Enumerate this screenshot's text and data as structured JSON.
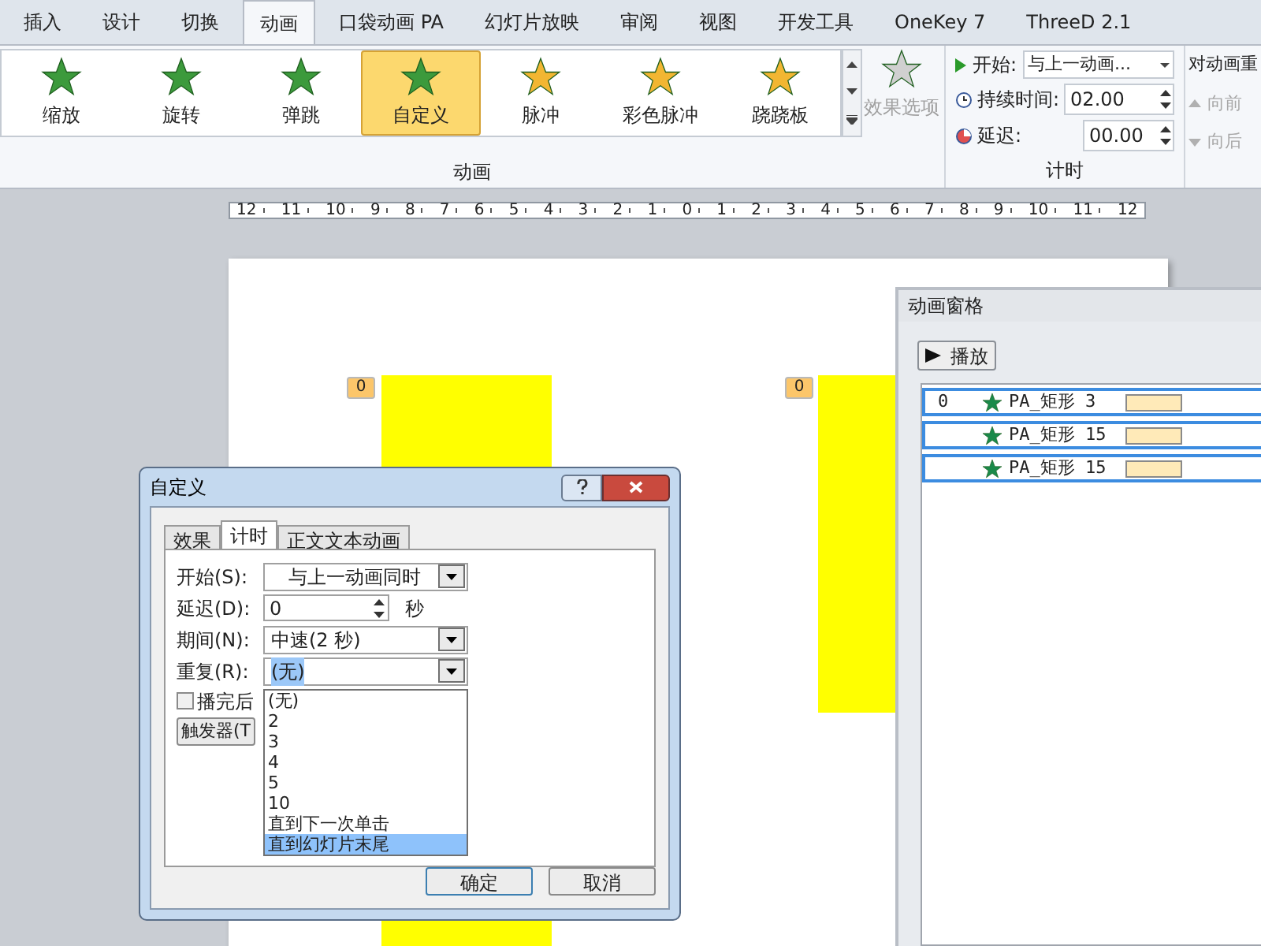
{
  "tabs": [
    {
      "label": "插入",
      "selected": false
    },
    {
      "label": "设计",
      "selected": false
    },
    {
      "label": "切换",
      "selected": false
    },
    {
      "label": "动画",
      "selected": true
    },
    {
      "label": "口袋动画 PA",
      "selected": false
    },
    {
      "label": "幻灯片放映",
      "selected": false
    },
    {
      "label": "审阅",
      "selected": false
    },
    {
      "label": "视图",
      "selected": false
    },
    {
      "label": "开发工具",
      "selected": false
    },
    {
      "label": "OneKey 7",
      "selected": false
    },
    {
      "label": "ThreeD 2.1",
      "selected": false
    }
  ],
  "animation_group": {
    "label": "动画",
    "items": [
      {
        "label": "缩放",
        "kind": "green",
        "selected": false
      },
      {
        "label": "旋转",
        "kind": "green",
        "selected": false
      },
      {
        "label": "弹跳",
        "kind": "green",
        "selected": false
      },
      {
        "label": "自定义",
        "kind": "green",
        "selected": true
      },
      {
        "label": "脉冲",
        "kind": "gold",
        "selected": false
      },
      {
        "label": "彩色脉冲",
        "kind": "gold",
        "selected": false
      },
      {
        "label": "跷跷板",
        "kind": "gold",
        "selected": false
      }
    ],
    "effect_options": {
      "label": "效果选项",
      "disabled": true
    }
  },
  "timing_group": {
    "label": "计时",
    "start": {
      "label": "开始:",
      "value": "与上一动画..."
    },
    "duration": {
      "label": "持续时间:",
      "value": "02.00"
    },
    "delay": {
      "label": "延迟:",
      "value": "00.00"
    }
  },
  "reorder_group": {
    "title": "对动画重",
    "items": [
      {
        "label": "向前",
        "disabled": true
      },
      {
        "label": "向后",
        "disabled": true
      }
    ]
  },
  "ruler": [
    "12",
    "11",
    "10",
    "9",
    "8",
    "7",
    "6",
    "5",
    "4",
    "3",
    "2",
    "1",
    "0",
    "1",
    "2",
    "3",
    "4",
    "5",
    "6",
    "7",
    "8",
    "9",
    "10",
    "11",
    "12"
  ],
  "slide": {
    "shapes": [
      {
        "badge": "0"
      },
      {
        "badge": "0"
      }
    ]
  },
  "animation_pane": {
    "title": "动画窗格",
    "play_button": "播放",
    "items": [
      {
        "index": "0",
        "name": "PA_矩形 3"
      },
      {
        "name": "PA_矩形 15"
      },
      {
        "name": "PA_矩形 15"
      }
    ]
  },
  "dialog": {
    "title": "自定义",
    "tabs": [
      {
        "label": "效果",
        "selected": false
      },
      {
        "label": "计时",
        "selected": true
      },
      {
        "label": "正文文本动画",
        "selected": false
      }
    ],
    "fields": [
      {
        "label": "开始(S):",
        "value": "与上一动画同时",
        "kind": "select"
      },
      {
        "label": "延迟(D):",
        "value": "0",
        "unit": "秒",
        "kind": "spinner"
      },
      {
        "label": "期间(N):",
        "value": "中速(2 秒)",
        "kind": "select"
      },
      {
        "label": "重复(R):",
        "value": "(无)",
        "kind": "select"
      }
    ],
    "rewind": {
      "label": "播完后",
      "checked": false
    },
    "trigger_button": "触发器(T",
    "dropdown": [
      {
        "label": "(无)",
        "selected": false
      },
      {
        "label": "2",
        "selected": false
      },
      {
        "label": "3",
        "selected": false
      },
      {
        "label": "4",
        "selected": false
      },
      {
        "label": "5",
        "selected": false
      },
      {
        "label": "10",
        "selected": false
      },
      {
        "label": "直到下一次单击",
        "selected": false
      },
      {
        "label": "直到幻灯片末尾",
        "selected": true
      }
    ],
    "buttons": [
      "确定",
      "取消"
    ]
  }
}
